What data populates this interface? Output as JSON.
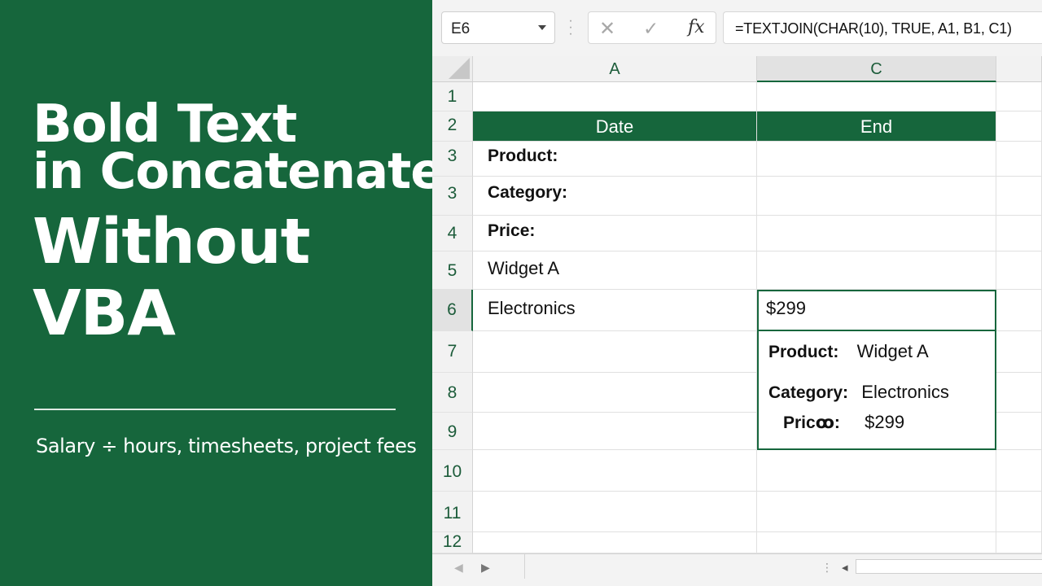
{
  "left": {
    "title_lines": [
      "Bold Text",
      "in Concatenate",
      "Without",
      "VBA"
    ],
    "subtitle": "Salary ÷ hours, timesheets, project fees"
  },
  "formula_bar": {
    "name_box": "E6",
    "formula": "=TEXTJOIN(CHAR(10), TRUE, A1, B1, C1)",
    "fx_label": "fx"
  },
  "columns": [
    "A",
    "C"
  ],
  "rows": [
    {
      "num": "1",
      "a": "",
      "c": ""
    },
    {
      "num": "2",
      "a": "Date",
      "c": "End"
    },
    {
      "num": "3",
      "a": "Product:",
      "c": ""
    },
    {
      "num": "3",
      "a": "Category:",
      "c": ""
    },
    {
      "num": "4",
      "a": "Price:",
      "c": ""
    },
    {
      "num": "5",
      "a": "Widget A",
      "c": ""
    },
    {
      "num": "6",
      "a": "Electronics",
      "c": "$299"
    },
    {
      "num": "7",
      "a": "",
      "c": ""
    },
    {
      "num": "8",
      "a": "",
      "c": ""
    },
    {
      "num": "9",
      "a": "",
      "c": ""
    },
    {
      "num": "10",
      "a": "",
      "c": ""
    },
    {
      "num": "11",
      "a": "",
      "c": ""
    },
    {
      "num": "12",
      "a": "",
      "c": ""
    }
  ],
  "result_box": {
    "product_label": "Product:",
    "product_value": "Widget A",
    "category_label": "Category:",
    "category_value": "Electronics",
    "price_label": "Pricꝏ:",
    "price_value": "$299"
  },
  "colors": {
    "brand_green": "#16663c",
    "header_fill": "#16663c"
  }
}
